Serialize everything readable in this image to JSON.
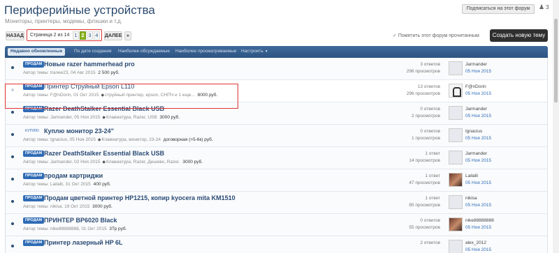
{
  "header": {
    "title": "Периферийные устройства",
    "description": "Мониторы, принтеры, модемы, флэшки и т.д.",
    "subscribe_label": "Подписаться на этот форум",
    "watchers_count": "3"
  },
  "pagination": {
    "back_label": "НАЗАД",
    "page_info": "Страница 2 из 14",
    "pages": [
      "1",
      "2",
      "3",
      "4"
    ],
    "current_page": "2",
    "next_label": "ДАЛЕЕ",
    "jump_label": "»"
  },
  "actions": {
    "mark_read_label": "Пометить этот форум прочитанным",
    "new_thread_label": "Создать новую тему"
  },
  "tabs": [
    {
      "label": "Недавно обновленные",
      "active": true
    },
    {
      "label": "По дате создания",
      "active": false
    },
    {
      "label": "Наиболее обсуждаемые",
      "active": false
    },
    {
      "label": "Наиболее просматриваемые",
      "active": false
    },
    {
      "label": "Настроить",
      "active": false
    }
  ],
  "threads": [
    {
      "prefix": "ПРОДАМ",
      "title": "Новые razer hammerhead pro",
      "bold": true,
      "author_date": "Автор темы: tranee23, 04 Авг 2015",
      "tags": "",
      "price": "2 500 руб.",
      "replies": "3 ответов",
      "views": "296 просмотров",
      "last_user": "Jarmander",
      "last_date": "05 Ноя 2015",
      "read": false
    },
    {
      "prefix": "ПРОДАМ",
      "title": "Принтер Струйный Epson L110",
      "bold": false,
      "author_date": "Автор темы: F@nDorin, 01 Окт 2015",
      "tags": "струйный принтер, epson, СНПЧ и 1 еще...",
      "price": "8000 руб.",
      "replies": "13 ответов",
      "views": "296 просмотров",
      "last_user": "F@nDorin",
      "last_date": "05 Ноя 2015",
      "read": true
    },
    {
      "prefix": "ПРОДАМ",
      "title": "Razer DeathStalker Essential Black USB",
      "bold": true,
      "author_date": "Автор темы: Jarmander, 05 Ноя 2015",
      "tags": "Клавиатура, Razer, USB",
      "price": "3000 руб.",
      "replies": "0 ответов",
      "views": "2 просмотров",
      "last_user": "Jarmander",
      "last_date": "05 Ноя 2015",
      "read": false
    },
    {
      "prefix": "КУПЛЮ",
      "title": "Куплю монитор 23-24\"",
      "bold": true,
      "author_date": "Автор темы: Ignacius, 05 Ноя 2015",
      "tags": "Клавиатура, монитор, 23-24",
      "price": "договорная (>5-6к) руб.",
      "replies": "0 ответов",
      "views": "1 просмотров",
      "last_user": "Ignacius",
      "last_date": "05 Ноя 2015",
      "read": false
    },
    {
      "prefix": "ПРОДАМ",
      "title": "Razer DeathStalker Essential Black USB",
      "bold": true,
      "author_date": "Автор темы: Jarmander, 02 Ноя 2015",
      "tags": "Клавиатура, Razer, Дешево, Razer.",
      "price": "3000 руб.",
      "replies": "1 ответ",
      "views": "14 просмотров",
      "last_user": "Jarmander",
      "last_date": "05 Ноя 2015",
      "read": false
    },
    {
      "prefix": "ПРОДАМ",
      "title": "продам картриджи",
      "bold": true,
      "author_date": "Автор темы: Lailalli, 31 Окт 2015",
      "tags": "",
      "price": "400 руб.",
      "replies": "1 ответ",
      "views": "47 просмотров",
      "last_user": "Lailalli",
      "last_date": "05 Ноя 2015",
      "read": false
    },
    {
      "prefix": "ПРОДАМ",
      "title": "Продам цветной принтер HP1215, копир kyocera mita KM1510",
      "bold": true,
      "author_date": "Автор темы: nikisa, 19 Окт 2015",
      "tags": "",
      "price": "3000 руб.",
      "replies": "1 ответ",
      "views": "85 просмотров",
      "last_user": "nikisa",
      "last_date": "05 Ноя 2015",
      "read": false
    },
    {
      "prefix": "ПРОДАМ",
      "title": "ПРИНТЕР BP6020 Black",
      "bold": true,
      "author_date": "Автор темы: nike88888888, 01 Окт 2015",
      "tags": "",
      "price": "3Тр руб.",
      "replies": "0 ответов",
      "views": "55 просмотров",
      "last_user": "nike88888888",
      "last_date": "05 Ноя 2015",
      "read": false
    },
    {
      "prefix": "ПРОДАМ",
      "title": "Принтер лазерный HP 6L",
      "bold": true,
      "author_date": "",
      "tags": "",
      "price": "",
      "replies": "2 ответов",
      "views": "",
      "last_user": "alex_2012",
      "last_date": "05 Ноя 2015",
      "read": false
    }
  ]
}
